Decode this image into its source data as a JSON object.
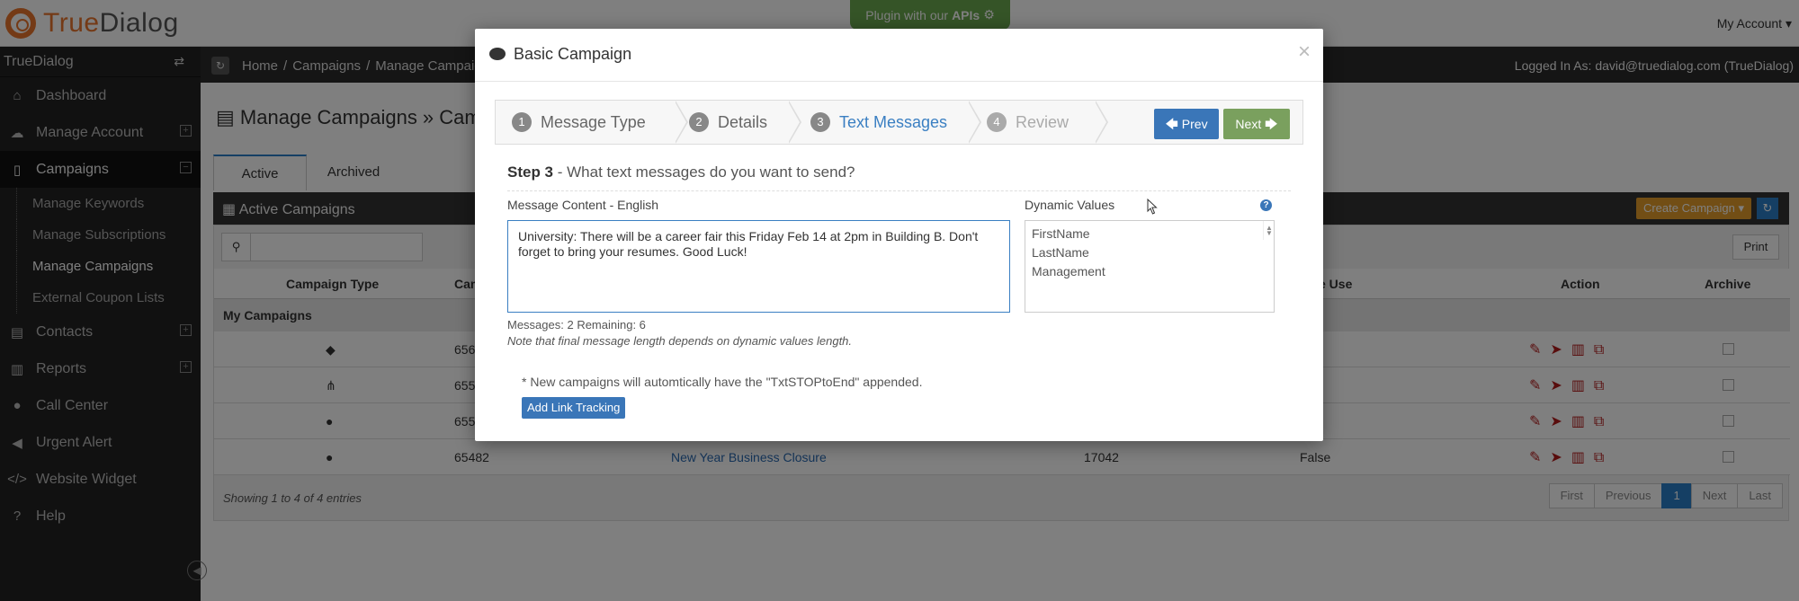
{
  "app": {
    "logo_prefix": "True",
    "logo_suffix": "Dialog",
    "plugin_text": "Plugin with our",
    "plugin_bold": "APIs",
    "my_account": "My Account",
    "logged_in": "Logged In As: david@truedialog.com (TrueDialog)"
  },
  "sidebar": {
    "title": "TrueDialog",
    "items": [
      {
        "label": "Dashboard",
        "icon": "home-icon"
      },
      {
        "label": "Manage Account",
        "icon": "cloud-icon"
      },
      {
        "label": "Campaigns",
        "icon": "mobile-icon"
      },
      {
        "label": "Contacts",
        "icon": "book-icon"
      },
      {
        "label": "Reports",
        "icon": "bar-chart-icon"
      },
      {
        "label": "Call Center",
        "icon": "chat-icon"
      },
      {
        "label": "Urgent Alert",
        "icon": "megaphone-icon"
      },
      {
        "label": "Website Widget",
        "icon": "code-icon"
      },
      {
        "label": "Help",
        "icon": "question-icon"
      }
    ],
    "subitems": [
      "Manage Keywords",
      "Manage Subscriptions",
      "Manage Campaigns",
      "External Coupon Lists"
    ]
  },
  "breadcrumb": [
    "Home",
    "Campaigns",
    "Manage Campaig"
  ],
  "page": {
    "title": "Manage Campaigns » Camp",
    "tabs": [
      "Active",
      "Archived"
    ],
    "panel_title": "Active Campaigns",
    "create_button": "Create Campaign",
    "print_button": "Print",
    "columns": [
      "Campaign Type",
      "Cam",
      "ngle Use",
      "Action",
      "Archive"
    ],
    "group": "My Campaigns",
    "rows": [
      {
        "id": "656",
        "name": "",
        "count": "",
        "single": "se"
      },
      {
        "id": "655",
        "name": "",
        "count": "",
        "single": "se"
      },
      {
        "id": "655",
        "name": "",
        "count": "",
        "single": "e"
      },
      {
        "id": "65482",
        "name": "New Year Business Closure",
        "count": "17042",
        "single": "False"
      }
    ],
    "showing": "Showing 1 to 4 of 4 entries",
    "pager": [
      "First",
      "Previous",
      "1",
      "Next",
      "Last"
    ]
  },
  "modal": {
    "title": "Basic Campaign",
    "close": "×",
    "steps": [
      {
        "num": "1",
        "label": "Message Type"
      },
      {
        "num": "2",
        "label": "Details"
      },
      {
        "num": "3",
        "label": "Text Messages"
      },
      {
        "num": "4",
        "label": "Review"
      }
    ],
    "prev_button": "Prev",
    "next_button": "Next",
    "step_title_bold": "Step 3",
    "step_title_rest": " - What text messages do you want to send?",
    "message_label": "Message Content - English",
    "message_value": "University: There will be a career fair this Friday Feb 14 at 2pm in Building B. Don't forget to bring your resumes. Good Luck!",
    "dynamic_label": "Dynamic Values",
    "dynamic_values": [
      "FirstName",
      "LastName",
      "Management"
    ],
    "counts": "Messages: 2 Remaining: 6",
    "length_note": "Note that final message length depends on dynamic values length.",
    "stop_note": "* New campaigns will automtically have the \"TxtSTOPtoEnd\" appended.",
    "link_tracking_button": "Add Link Tracking"
  },
  "colors": {
    "accent_blue": "#3a76b8",
    "next_green": "#7aa05e",
    "brand_orange": "#e8742c",
    "sidebar_bg": "#222222"
  }
}
